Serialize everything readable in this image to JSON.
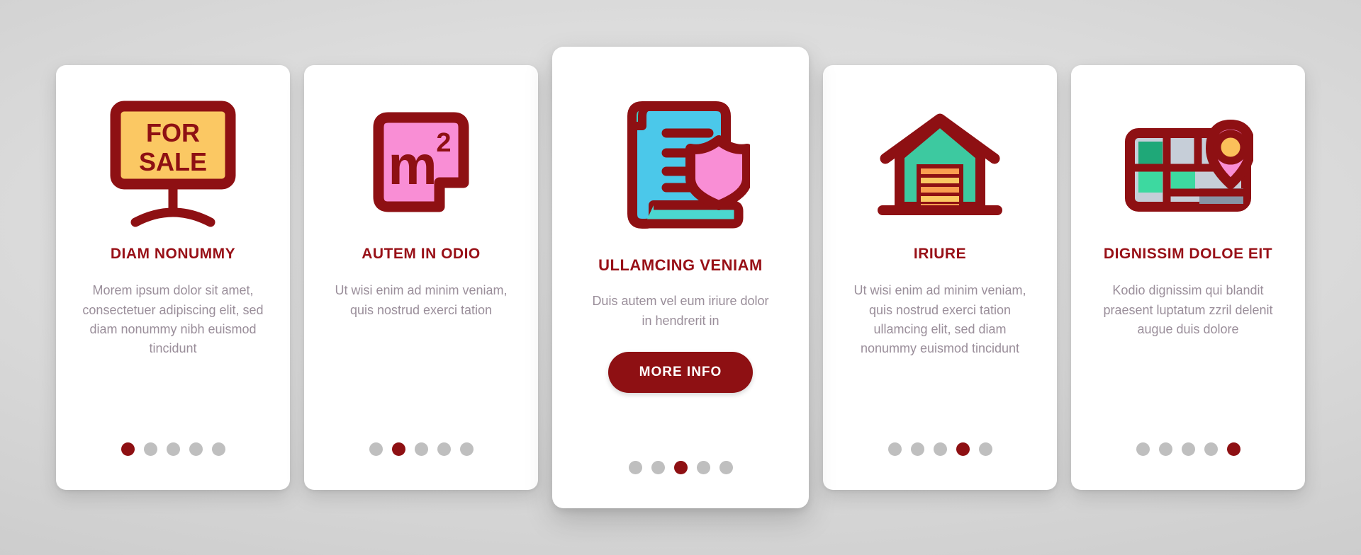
{
  "theme": {
    "accent": "#981017",
    "button_bg": "#8e1013",
    "body_text": "#9a8e9a",
    "dot_inactive": "#bfbfbf",
    "dot_active": "#8e1013",
    "card_bg": "#ffffff",
    "page_bg": "#d4d4d4"
  },
  "cards": [
    {
      "icon": "for-sale-sign-icon",
      "icon_text_line1": "FOR",
      "icon_text_line2": "SALE",
      "title": "DIAM NONUMMY",
      "body": "Morem ipsum dolor sit amet, consectetuer adipiscing elit, sed diam nonummy nibh euismod tincidunt",
      "dots_total": 5,
      "dot_active_index": 0,
      "featured": false,
      "has_button": false
    },
    {
      "icon": "square-meter-icon",
      "icon_text_line1": "m",
      "icon_text_line2": "2",
      "title": "AUTEM IN ODIO",
      "body": "Ut wisi enim ad minim veniam, quis nostrud exerci tation",
      "dots_total": 5,
      "dot_active_index": 1,
      "featured": false,
      "has_button": false
    },
    {
      "icon": "document-shield-icon",
      "title": "ULLAMCING VENIAM",
      "body": "Duis autem vel eum iriure dolor in hendrerit in",
      "button_label": "MORE INFO",
      "dots_total": 5,
      "dot_active_index": 2,
      "featured": true,
      "has_button": true
    },
    {
      "icon": "garage-icon",
      "title": "IRIURE",
      "body": "Ut wisi enim ad minim veniam, quis nostrud exerci tation ullamcing elit, sed diam nonummy euismod tincidunt",
      "dots_total": 5,
      "dot_active_index": 3,
      "featured": false,
      "has_button": false
    },
    {
      "icon": "map-location-pin-icon",
      "title": "DIGNISSIM DOLOE EIT",
      "body": "Kodio dignissim qui blandit praesent luptatum zzril delenit augue duis dolore",
      "dots_total": 5,
      "dot_active_index": 4,
      "featured": false,
      "has_button": false
    }
  ]
}
